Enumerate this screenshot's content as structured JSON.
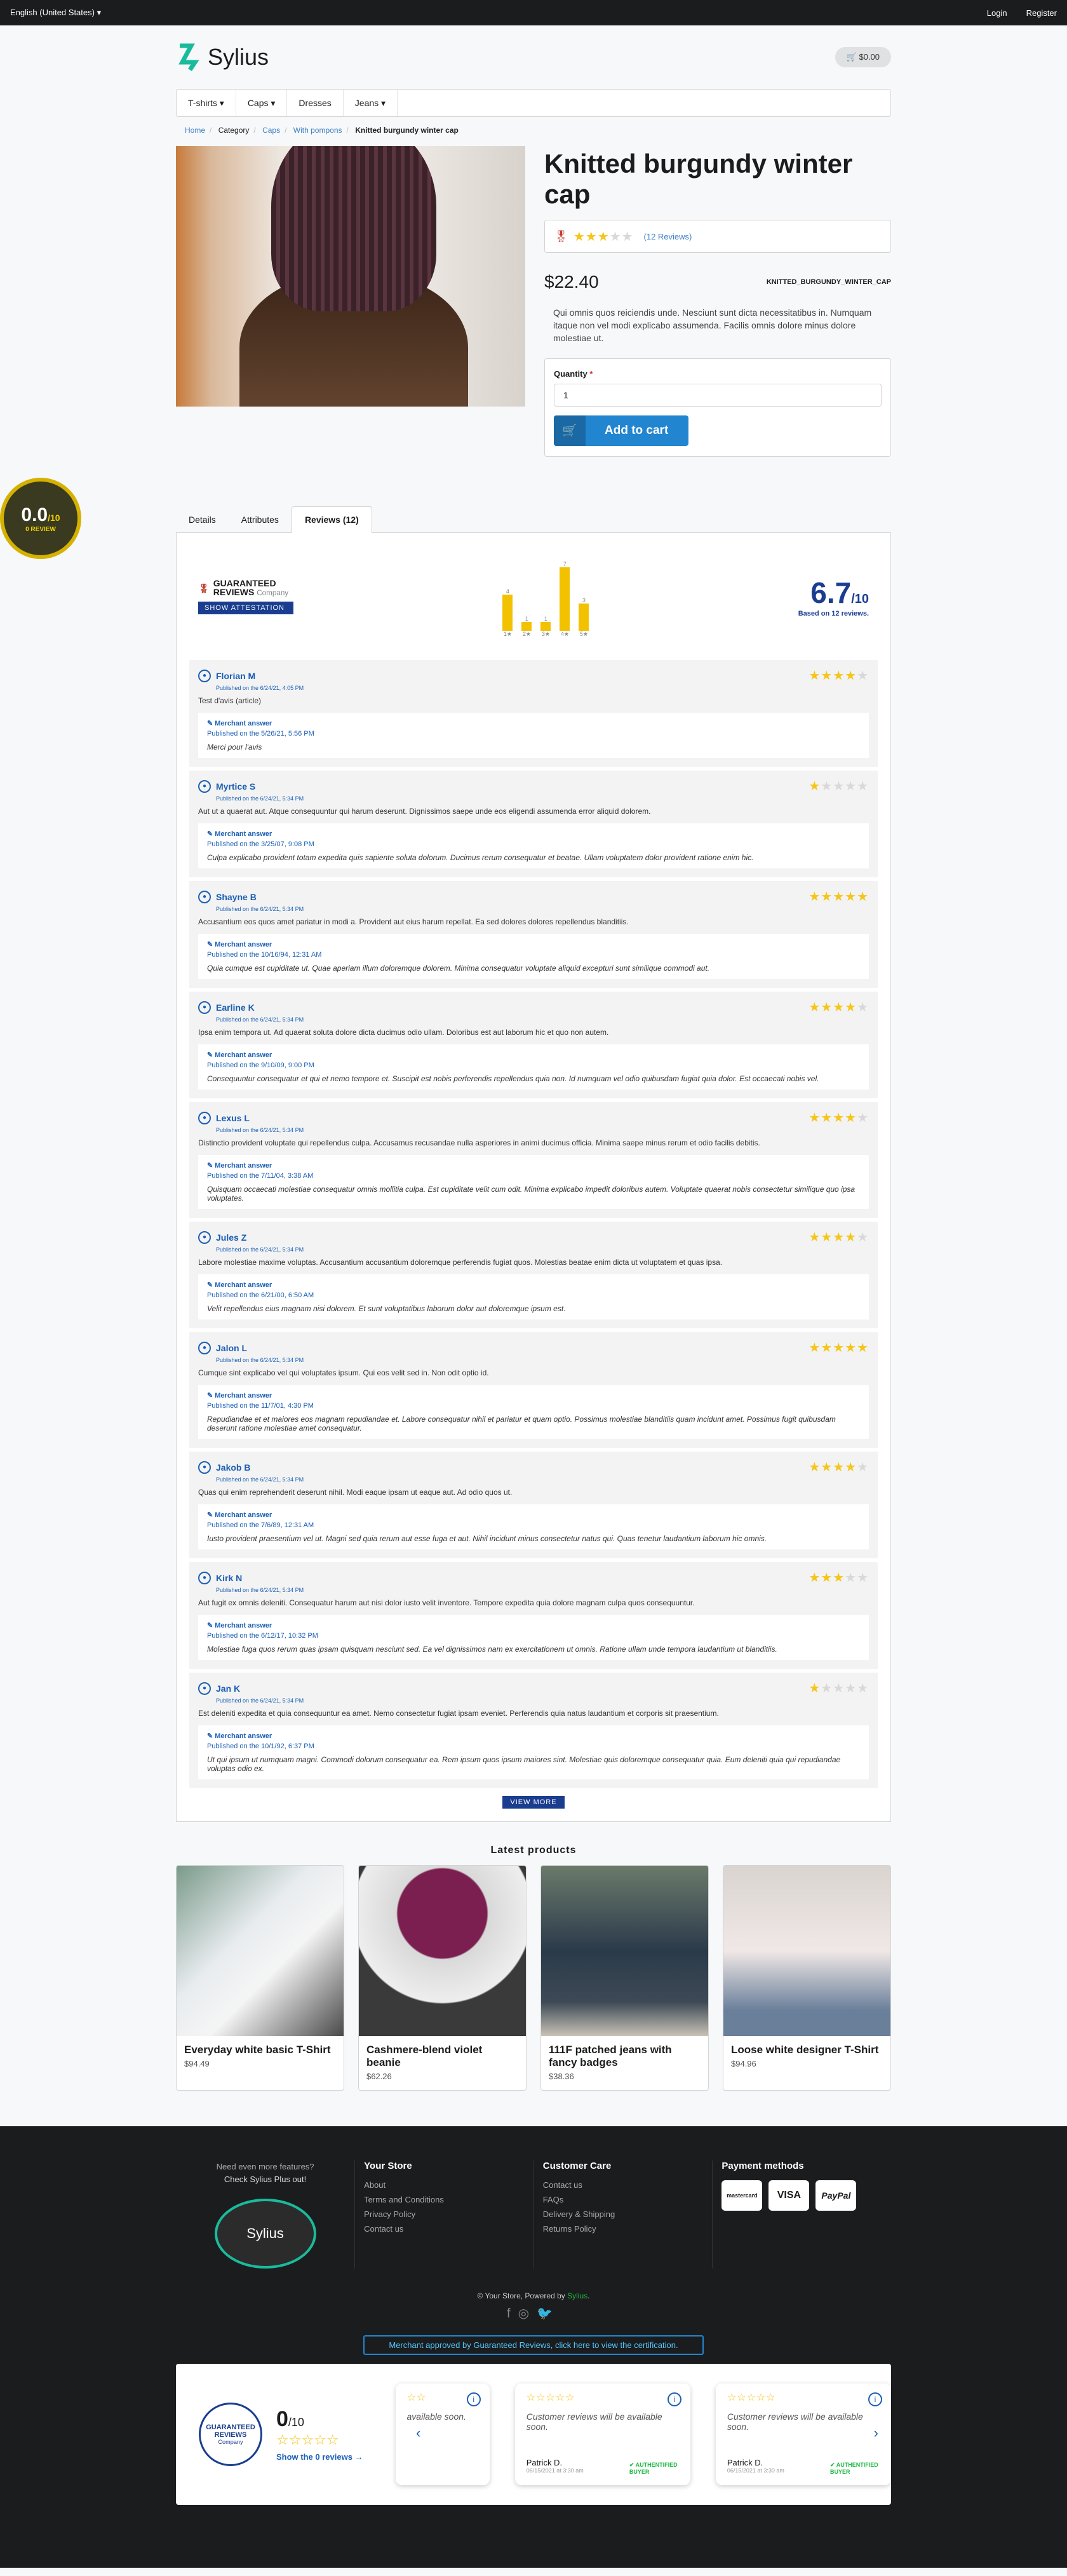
{
  "topbar": {
    "locale": "English (United States)",
    "login": "Login",
    "register": "Register"
  },
  "header": {
    "brand": "Sylius",
    "cart_total": "$0.00"
  },
  "menu": [
    "T-shirts",
    "Caps",
    "Dresses",
    "Jeans"
  ],
  "breadcrumb": [
    "Home",
    "Category",
    "Caps",
    "With pompons",
    "Knitted burgundy winter cap"
  ],
  "product": {
    "title": "Knitted burgundy winter cap",
    "rating_stars": 3,
    "reviews_link": "(12 Reviews)",
    "price": "$22.40",
    "code": "KNITTED_BURGUNDY_WINTER_CAP",
    "description": "Qui omnis quos reiciendis unde. Nesciunt sunt dicta necessitatibus in. Numquam itaque non vel modi explicabo assumenda. Facilis omnis dolore minus dolore molestiae ut.",
    "quantity_label": "Quantity",
    "quantity_value": "1",
    "add_to_cart": "Add to cart"
  },
  "tabs": [
    "Details",
    "Attributes",
    "Reviews (12)"
  ],
  "guaranteed": {
    "brand_line1": "GUARANTEED",
    "brand_line2": "REVIEWS",
    "brand_line3": "Company",
    "attest": "SHOW ATTESTATION",
    "score": "6.7",
    "score_max": "/10",
    "based_on": "Based on 12 reviews.",
    "histogram": [
      {
        "label": "1★",
        "value": 4
      },
      {
        "label": "2★",
        "value": 1
      },
      {
        "label": "3★",
        "value": 1
      },
      {
        "label": "4★",
        "value": 7
      },
      {
        "label": "5★",
        "value": 3
      }
    ],
    "badge_score": "0.0",
    "badge_max": "/10",
    "badge_label": "0 REVIEW"
  },
  "reviews": [
    {
      "name": "Florian M",
      "date": "Published on the 6/24/21, 4:05 PM",
      "stars": 4,
      "text": "Test d'avis (article)",
      "merchant_title": "Merchant answer",
      "merchant_date": "Published on the 5/26/21, 5:56 PM",
      "merchant_text": "Merci pour l'avis"
    },
    {
      "name": "Myrtice S",
      "date": "Published on the 6/24/21, 5:34 PM",
      "stars": 1,
      "text": "Aut ut a quaerat aut. Atque consequuntur qui harum deserunt. Dignissimos saepe unde eos eligendi assumenda error aliquid dolorem.",
      "merchant_title": "Merchant answer",
      "merchant_date": "Published on the 3/25/07, 9:08 PM",
      "merchant_text": "Culpa explicabo provident totam expedita quis sapiente soluta dolorum. Ducimus rerum consequatur et beatae. Ullam voluptatem dolor provident ratione enim hic."
    },
    {
      "name": "Shayne B",
      "date": "Published on the 6/24/21, 5:34 PM",
      "stars": 5,
      "text": "Accusantium eos quos amet pariatur in modi a. Provident aut eius harum repellat. Ea sed dolores dolores repellendus blanditiis.",
      "merchant_title": "Merchant answer",
      "merchant_date": "Published on the 10/16/94, 12:31 AM",
      "merchant_text": "Quia cumque est cupiditate ut. Quae aperiam illum doloremque dolorem. Minima consequatur voluptate aliquid excepturi sunt similique commodi aut."
    },
    {
      "name": "Earline K",
      "date": "Published on the 6/24/21, 5:34 PM",
      "stars": 4,
      "text": "Ipsa enim tempora ut. Ad quaerat soluta dolore dicta ducimus odio ullam. Doloribus est aut laborum hic et quo non autem.",
      "merchant_title": "Merchant answer",
      "merchant_date": "Published on the 9/10/09, 9:00 PM",
      "merchant_text": "Consequuntur consequatur et qui et nemo tempore et. Suscipit est nobis perferendis repellendus quia non. Id numquam vel odio quibusdam fugiat quia dolor. Est occaecati nobis vel."
    },
    {
      "name": "Lexus L",
      "date": "Published on the 6/24/21, 5:34 PM",
      "stars": 4,
      "text": "Distinctio provident voluptate qui repellendus culpa. Accusamus recusandae nulla asperiores in animi ducimus officia. Minima saepe minus rerum et odio facilis debitis.",
      "merchant_title": "Merchant answer",
      "merchant_date": "Published on the 7/11/04, 3:38 AM",
      "merchant_text": "Quisquam occaecati molestiae consequatur omnis mollitia culpa. Est cupiditate velit cum odit. Minima explicabo impedit doloribus autem. Voluptate quaerat nobis consectetur similique quo ipsa voluptates."
    },
    {
      "name": "Jules Z",
      "date": "Published on the 6/24/21, 5:34 PM",
      "stars": 4,
      "text": "Labore molestiae maxime voluptas. Accusantium accusantium doloremque perferendis fugiat quos. Molestias beatae enim dicta ut voluptatem et quas ipsa.",
      "merchant_title": "Merchant answer",
      "merchant_date": "Published on the 6/21/00, 6:50 AM",
      "merchant_text": "Velit repellendus eius magnam nisi dolorem. Et sunt voluptatibus laborum dolor aut doloremque ipsum est."
    },
    {
      "name": "Jalon L",
      "date": "Published on the 6/24/21, 5:34 PM",
      "stars": 5,
      "text": "Cumque sint explicabo vel qui voluptates ipsum. Qui eos velit sed in. Non odit optio id.",
      "merchant_title": "Merchant answer",
      "merchant_date": "Published on the 11/7/01, 4:30 PM",
      "merchant_text": "Repudiandae et et maiores eos magnam repudiandae et. Labore consequatur nihil et pariatur et quam optio. Possimus molestiae blanditiis quam incidunt amet. Possimus fugit quibusdam deserunt ratione molestiae amet consequatur."
    },
    {
      "name": "Jakob B",
      "date": "Published on the 6/24/21, 5:34 PM",
      "stars": 4,
      "text": "Quas qui enim reprehenderit deserunt nihil. Modi eaque ipsam ut eaque aut. Ad odio quos ut.",
      "merchant_title": "Merchant answer",
      "merchant_date": "Published on the 7/6/89, 12:31 AM",
      "merchant_text": "Iusto provident praesentium vel ut. Magni sed quia rerum aut esse fuga et aut. Nihil incidunt minus consectetur natus qui. Quas tenetur laudantium laborum hic omnis."
    },
    {
      "name": "Kirk N",
      "date": "Published on the 6/24/21, 5:34 PM",
      "stars": 3,
      "text": "Aut fugit ex omnis deleniti. Consequatur harum aut nisi dolor iusto velit inventore. Tempore expedita quia dolore magnam culpa quos consequuntur.",
      "merchant_title": "Merchant answer",
      "merchant_date": "Published on the 6/12/17, 10:32 PM",
      "merchant_text": "Molestiae fuga quos rerum quas ipsam quisquam nesciunt sed. Ea vel dignissimos nam ex exercitationem ut omnis. Ratione ullam unde tempora laudantium ut blanditiis."
    },
    {
      "name": "Jan K",
      "date": "Published on the 6/24/21, 5:34 PM",
      "stars": 1,
      "text": "Est deleniti expedita et quia consequuntur ea amet. Nemo consectetur fugiat ipsam eveniet. Perferendis quia natus laudantium et corporis sit praesentium.",
      "merchant_title": "Merchant answer",
      "merchant_date": "Published on the 10/1/92, 6:37 PM",
      "merchant_text": "Ut qui ipsum ut numquam magni. Commodi dolorum consequatur ea. Rem ipsum quos ipsum maiores sint. Molestiae quis doloremque consequatur quia. Eum deleniti quia qui repudiandae voluptas odio ex."
    }
  ],
  "view_more": "VIEW MORE",
  "latest": {
    "title": "Latest products",
    "items": [
      {
        "name": "Everyday white basic T-Shirt",
        "price": "$94.49"
      },
      {
        "name": "Cashmere-blend violet beanie",
        "price": "$62.26"
      },
      {
        "name": "111F patched jeans with fancy badges",
        "price": "$38.36"
      },
      {
        "name": "Loose white designer T-Shirt",
        "price": "$94.96"
      }
    ]
  },
  "footer": {
    "more_line1": "Need even more features?",
    "more_line2": "Check Sylius Plus out!",
    "plus_logo": "Sylius",
    "store_title": "Your Store",
    "store_links": [
      "About",
      "Terms and Conditions",
      "Privacy Policy",
      "Contact us"
    ],
    "care_title": "Customer Care",
    "care_links": [
      "Contact us",
      "FAQs",
      "Delivery & Shipping",
      "Returns Policy"
    ],
    "payment_title": "Payment methods",
    "payments": [
      "mastercard",
      "VISA",
      "PayPal"
    ],
    "copyright": "© Your Store, Powered by",
    "powered": "Sylius",
    "cert_button": "Merchant approved by Guaranteed Reviews, click here to view the certification."
  },
  "widget": {
    "seal_line1": "GUARANTEED",
    "seal_line2": "REVIEWS",
    "seal_line3": "Company",
    "score": "0",
    "score_max": "/10",
    "show_reviews": "Show the 0 reviews",
    "card_message": "Customer reviews will be available soon.",
    "card_partial_message": "available soon.",
    "author": "Patrick D.",
    "author_date": "06/15/2021 at 3:30 am",
    "authentified": "AUTHENTIFIED BUYER"
  }
}
